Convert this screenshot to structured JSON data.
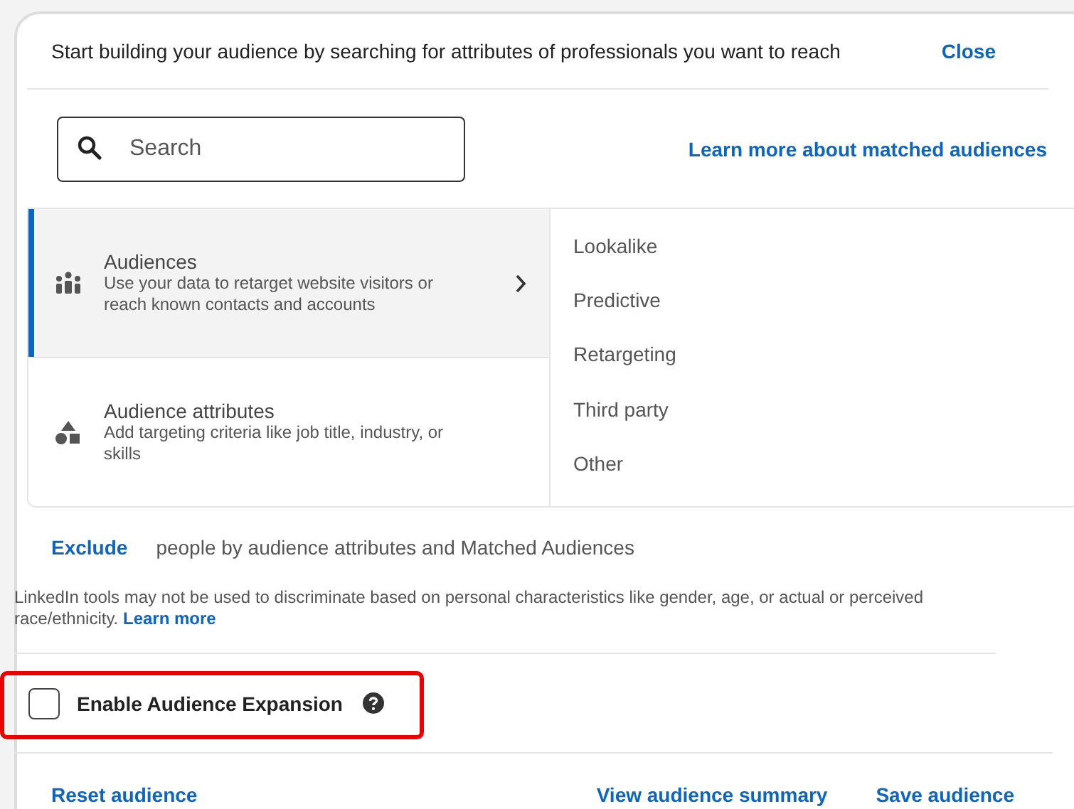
{
  "header": {
    "instruction": "Start building your audience by searching for attributes of professionals you want to reach",
    "close": "Close"
  },
  "search": {
    "placeholder": "Search"
  },
  "learn_more_link": "Learn more about matched audiences",
  "categories": [
    {
      "kind": "people",
      "title": "Audiences",
      "description": "Use your data to retarget website visitors or reach known contacts and accounts",
      "selected": true
    },
    {
      "kind": "shapes",
      "title": "Audience attributes",
      "description": "Add targeting criteria like job title, industry, or skills",
      "selected": false
    }
  ],
  "subcategories": [
    "Lookalike",
    "Predictive",
    "Retargeting",
    "Third party",
    "Other"
  ],
  "exclude": {
    "link": "Exclude",
    "text": "people by audience attributes and Matched Audiences"
  },
  "disclaimer": {
    "text": "LinkedIn tools may not be used to discriminate based on personal characteristics like gender, age, or actual or perceived race/ethnicity.",
    "link": "Learn more"
  },
  "expansion": {
    "label": "Enable Audience Expansion",
    "checked": false,
    "highlighted": true
  },
  "footer": {
    "reset": "Reset audience",
    "summary": "View audience summary",
    "save": "Save audience"
  }
}
